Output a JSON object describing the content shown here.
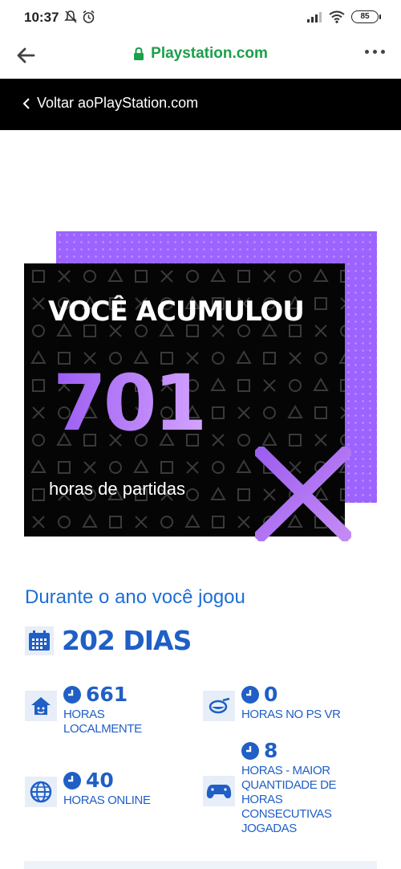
{
  "status": {
    "time": "10:37",
    "battery": "85"
  },
  "browser": {
    "url": "Playstation.com"
  },
  "nav": {
    "back_label": "Voltar aoPlayStation.com"
  },
  "hero": {
    "title": "VOCÊ ACUMULOU",
    "number": "701",
    "subtitle": "horas de partidas"
  },
  "stats": {
    "intro": "Durante o ano você jogou",
    "days": "202 DIAS",
    "items": [
      {
        "icon": "home-icon",
        "value": "661",
        "label": "HORAS LOCALMENTE"
      },
      {
        "icon": "vr-headset-icon",
        "value": "0",
        "label": "HORAS NO PS VR"
      },
      {
        "icon": "globe-icon",
        "value": "40",
        "label": "HORAS ONLINE"
      },
      {
        "icon": "gamepad-icon",
        "value": "8",
        "label": "HORAS - MAIOR QUANTIDADE DE HORAS CONSECUTIVAS JOGADAS"
      }
    ]
  },
  "colors": {
    "accent_blue": "#1f5fc6",
    "purple": "#9c63ff",
    "url_green": "#1aa04a"
  }
}
